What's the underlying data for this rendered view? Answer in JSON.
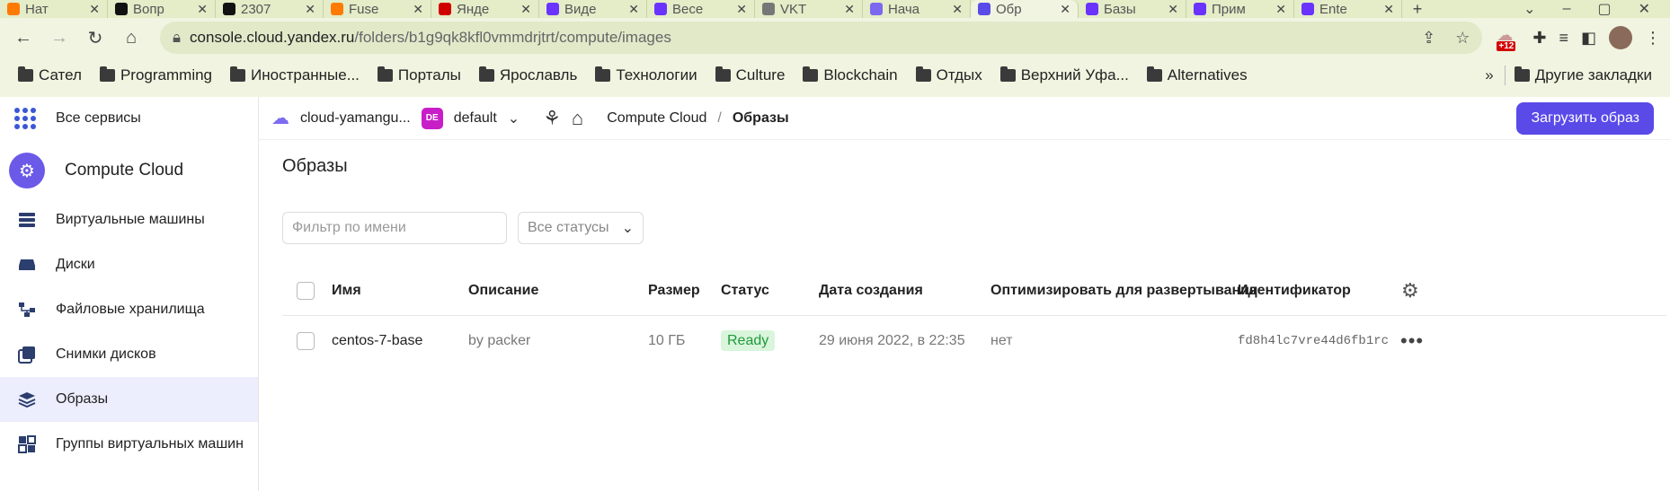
{
  "browser": {
    "tabs": [
      {
        "label": "Нат",
        "color": "#ff7a00"
      },
      {
        "label": "Вопр",
        "color": "#111111"
      },
      {
        "label": "2307",
        "color": "#111111"
      },
      {
        "label": "Fuse",
        "color": "#ff7a00"
      },
      {
        "label": "Янде",
        "color": "#d10000"
      },
      {
        "label": "Виде",
        "color": "#6a33ff"
      },
      {
        "label": "Весе",
        "color": "#6a33ff"
      },
      {
        "label": "VKT",
        "color": "#777777"
      },
      {
        "label": "Нача",
        "color": "#7b68ee"
      },
      {
        "label": "Обр",
        "color": "#5a4ae8",
        "active": true
      },
      {
        "label": "Базы",
        "color": "#6a33ff"
      },
      {
        "label": "Прим",
        "color": "#6a33ff"
      },
      {
        "label": "Ente",
        "color": "#6a33ff"
      }
    ],
    "url_host": "console.cloud.yandex.ru",
    "url_path": "/folders/b1g9qk8kfl0vmmdrjtrt/compute/images",
    "ext_badge": "+12",
    "bookmarks": [
      "Сател",
      "Programming",
      "Иностранные...",
      "Порталы",
      "Ярославль",
      "Технологии",
      "Culture",
      "Blockchain",
      "Отдых",
      "Верхний Уфа...",
      "Alternatives"
    ],
    "bookmarks_more": "»",
    "other_bookmarks": "Другие закладки"
  },
  "sidebar": {
    "all_services": "Все сервисы",
    "service_name": "Compute Cloud",
    "items": [
      {
        "label": "Виртуальные машины",
        "icon": "server-icon"
      },
      {
        "label": "Диски",
        "icon": "disk-icon"
      },
      {
        "label": "Файловые хранилища",
        "icon": "file-storage-icon"
      },
      {
        "label": "Снимки дисков",
        "icon": "snapshot-icon"
      },
      {
        "label": "Образы",
        "icon": "images-icon",
        "active": true
      },
      {
        "label": "Группы виртуальных машин",
        "icon": "instance-group-icon"
      }
    ]
  },
  "header": {
    "cloud": "cloud-yamangu...",
    "folder_badge": "DE",
    "folder": "default",
    "crumb_service": "Compute Cloud",
    "crumb_sep": "/",
    "crumb_current": "Образы",
    "upload_button": "Загрузить образ"
  },
  "page": {
    "title": "Образы",
    "filter_placeholder": "Фильтр по имени",
    "status_select": "Все статусы"
  },
  "table": {
    "columns": [
      "Имя",
      "Описание",
      "Размер",
      "Статус",
      "Дата создания",
      "Оптимизировать для развертывания",
      "Идентификатор"
    ],
    "rows": [
      {
        "name": "centos-7-base",
        "description": "by packer",
        "size": "10 ГБ",
        "status": "Ready",
        "created": "29 июня 2022, в 22:35",
        "optimize": "нет",
        "id": "fd8h4lc7vre44d6fb1rc"
      }
    ]
  },
  "colors": {
    "accent": "#5a4ae8",
    "status_ready_bg": "#d9f5dc",
    "status_ready_fg": "#1f9a3a",
    "active_nav_bg": "#ecedfd"
  }
}
